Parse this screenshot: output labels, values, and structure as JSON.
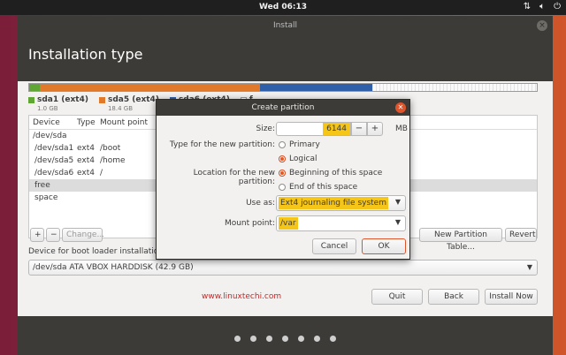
{
  "topbar": {
    "clock": "Wed 06:13",
    "icons": [
      "network-icon",
      "volume-icon",
      "power-icon"
    ]
  },
  "window": {
    "title": "Install",
    "close_label": "×"
  },
  "page": {
    "title": "Installation type"
  },
  "partitions_legend": [
    {
      "name": "sda1 (ext4)",
      "size": "1.0 GB",
      "color": "#5fa634"
    },
    {
      "name": "sda5 (ext4)",
      "size": "18.4 GB",
      "color": "#e0792a"
    },
    {
      "name": "sda6 (ext4)",
      "size": "",
      "color": "#2f5fa8"
    },
    {
      "name": "f",
      "size": "",
      "color": "#ffffff"
    }
  ],
  "table": {
    "headers": {
      "device": "Device",
      "type": "Type",
      "mount": "Mount point"
    },
    "rows": [
      {
        "device": "/dev/sda",
        "type": "",
        "mount": "",
        "indent": false,
        "selected": false
      },
      {
        "device": "/dev/sda1",
        "type": "ext4",
        "mount": "/boot",
        "indent": true,
        "selected": false
      },
      {
        "device": "/dev/sda5",
        "type": "ext4",
        "mount": "/home",
        "indent": true,
        "selected": false
      },
      {
        "device": "/dev/sda6",
        "type": "ext4",
        "mount": "/",
        "indent": true,
        "selected": false
      },
      {
        "device": "free space",
        "type": "",
        "mount": "",
        "indent": true,
        "selected": true
      }
    ]
  },
  "table_buttons": {
    "add": "+",
    "remove": "−",
    "change": "Change...",
    "new_table": "New Partition Table...",
    "revert": "Revert"
  },
  "boot": {
    "label": "Device for boot loader installation",
    "value": "/dev/sda   ATA VBOX HARDDISK (42.9 GB)"
  },
  "watermark": "www.linuxtechi.com",
  "nav_buttons": {
    "quit": "Quit",
    "back": "Back",
    "install": "Install Now"
  },
  "progress": {
    "total_steps": 7
  },
  "dialog": {
    "title": "Create partition",
    "size_label": "Size:",
    "size_value": "6144",
    "size_unit": "MB",
    "decrement": "−",
    "increment": "+",
    "type_label": "Type for the new partition:",
    "type_options": [
      {
        "label": "Primary",
        "selected": false
      },
      {
        "label": "Logical",
        "selected": true
      }
    ],
    "location_label": "Location for the new partition:",
    "location_options": [
      {
        "label": "Beginning of this space",
        "selected": true
      },
      {
        "label": "End of this space",
        "selected": false
      }
    ],
    "use_as_label": "Use as:",
    "use_as_value": "Ext4 journaling file system",
    "mount_label": "Mount point:",
    "mount_value": "/var",
    "cancel": "Cancel",
    "ok": "OK"
  },
  "colors": {
    "accent": "#e95420",
    "highlight": "#f5c518",
    "header": "#3c3b37"
  }
}
